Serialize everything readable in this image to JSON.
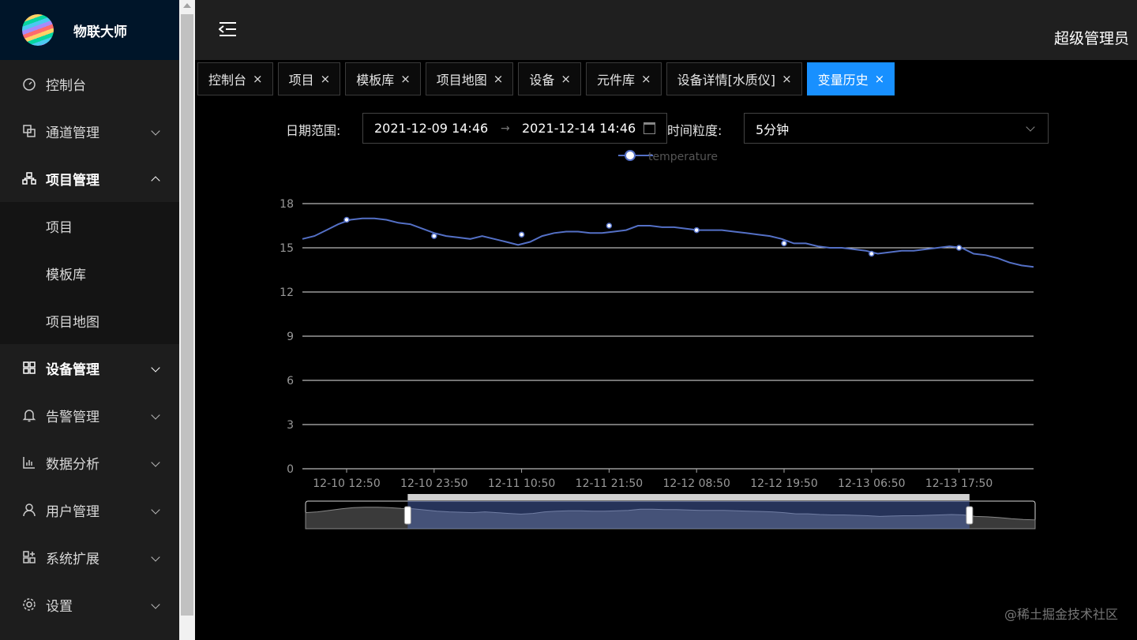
{
  "app": {
    "name": "物联大师",
    "user": "超级管理员",
    "watermark": "@稀土掘金技术社区"
  },
  "sidebar": {
    "items": [
      {
        "label": "控制台",
        "icon": "dashboard-icon",
        "has_chevron": false
      },
      {
        "label": "通道管理",
        "icon": "channel-icon",
        "has_chevron": true
      },
      {
        "label": "项目管理",
        "icon": "project-icon",
        "has_chevron": true,
        "open": true,
        "children": [
          {
            "label": "项目"
          },
          {
            "label": "模板库"
          },
          {
            "label": "项目地图"
          }
        ]
      },
      {
        "label": "设备管理",
        "icon": "device-icon",
        "has_chevron": true,
        "bold": true
      },
      {
        "label": "告警管理",
        "icon": "bell-icon",
        "has_chevron": true
      },
      {
        "label": "数据分析",
        "icon": "bar-chart-icon",
        "has_chevron": true
      },
      {
        "label": "用户管理",
        "icon": "user-icon",
        "has_chevron": true
      },
      {
        "label": "系统扩展",
        "icon": "extension-icon",
        "has_chevron": true
      },
      {
        "label": "设置",
        "icon": "gear-icon",
        "has_chevron": true
      }
    ]
  },
  "tabs": [
    {
      "label": "控制台"
    },
    {
      "label": "项目"
    },
    {
      "label": "模板库"
    },
    {
      "label": "项目地图"
    },
    {
      "label": "设备"
    },
    {
      "label": "元件库"
    },
    {
      "label": "设备详情[水质仪]"
    },
    {
      "label": "变量历史",
      "active": true
    }
  ],
  "filters": {
    "date_label": "日期范围:",
    "start": "2021-12-09 14:46",
    "arrow": "→",
    "end": "2021-12-14 14:46",
    "granularity_label": "时间粒度:",
    "granularity": "5分钟"
  },
  "colors": {
    "accent": "#1890ff",
    "series": "#5470c6",
    "sidebar_logo_bg": "#001529"
  },
  "chart_data": {
    "type": "line",
    "series": [
      {
        "name": "temperature",
        "x": [
          "12-10 12:50",
          "12-10 23:50",
          "12-11 10:50",
          "12-11 21:50",
          "12-12 08:50",
          "12-12 19:50",
          "12-13 06:50",
          "12-13 17:50"
        ],
        "y": [
          16.9,
          15.8,
          15.9,
          16.5,
          16.2,
          15.3,
          14.6,
          15.0
        ]
      }
    ],
    "ylim": [
      0,
      18
    ],
    "yticks": [
      0,
      3,
      6,
      9,
      12,
      15,
      18
    ],
    "xticks": [
      "12-10 12:50",
      "12-10 23:50",
      "12-11 10:50",
      "12-11 21:50",
      "12-12 08:50",
      "12-12 19:50",
      "12-13 06:50",
      "12-13 17:50"
    ],
    "line_profile": [
      15.6,
      15.8,
      16.2,
      16.6,
      16.9,
      17.0,
      17.0,
      16.9,
      16.7,
      16.6,
      16.3,
      16.0,
      15.8,
      15.7,
      15.6,
      15.8,
      15.6,
      15.4,
      15.2,
      15.4,
      15.8,
      16.0,
      16.1,
      16.1,
      16.0,
      16.0,
      16.1,
      16.2,
      16.5,
      16.5,
      16.4,
      16.4,
      16.3,
      16.2,
      16.2,
      16.2,
      16.1,
      16.0,
      15.9,
      15.8,
      15.6,
      15.3,
      15.3,
      15.1,
      15.0,
      15.0,
      14.9,
      14.8,
      14.6,
      14.7,
      14.8,
      14.8,
      14.9,
      15.0,
      15.1,
      15.0,
      14.6,
      14.5,
      14.3,
      14.0,
      13.8,
      13.7
    ],
    "legend": "top-center",
    "grid": true,
    "datazoom": {
      "start_fraction": 0.14,
      "end_fraction": 0.91
    }
  }
}
